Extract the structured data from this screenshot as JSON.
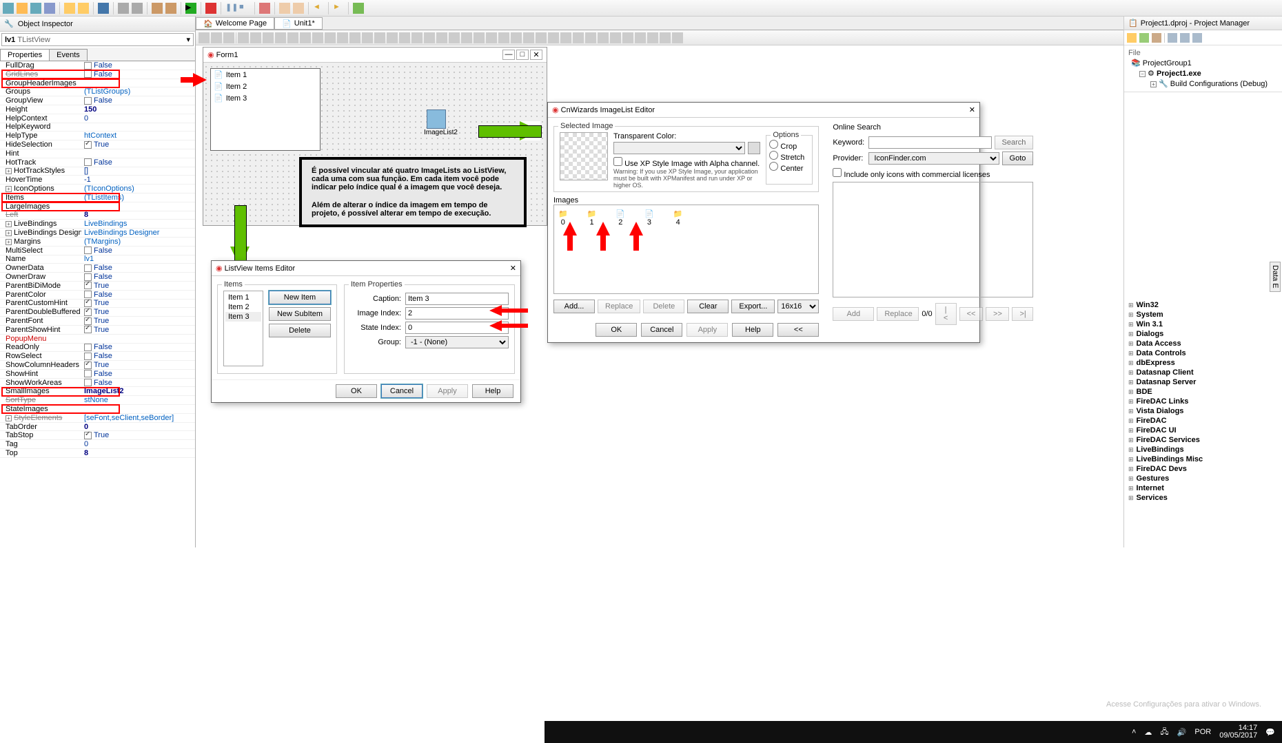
{
  "toolbar_icons": [
    "new",
    "open",
    "open2",
    "save",
    "save-all",
    "sep",
    "folder",
    "add-folder",
    "sep",
    "disk",
    "sep",
    "undo",
    "redo",
    "sep",
    "package",
    "package2",
    "sep",
    "run",
    "sep",
    "bug",
    "sep",
    "pause",
    "step",
    "sep",
    "stop",
    "sep",
    "brush",
    "brush2",
    "sep",
    "nav-back",
    "sep",
    "nav-fwd",
    "sep",
    "books"
  ],
  "object_inspector": {
    "title": "Object Inspector",
    "component": "lv1",
    "component_type": "TListView",
    "tabs": [
      "Properties",
      "Events"
    ],
    "active_tab": 0,
    "properties": [
      {
        "n": "FullDrag",
        "v": "False",
        "chk": false
      },
      {
        "n": "GridLines",
        "v": "False",
        "chk": false,
        "strike": true,
        "boxed": true
      },
      {
        "n": "GroupHeaderImages",
        "v": "",
        "boxed": true
      },
      {
        "n": "Groups",
        "v": "(TListGroups)",
        "link": true
      },
      {
        "n": "GroupView",
        "v": "False",
        "chk": false
      },
      {
        "n": "Height",
        "v": "150",
        "bold": true
      },
      {
        "n": "HelpContext",
        "v": "0"
      },
      {
        "n": "HelpKeyword",
        "v": ""
      },
      {
        "n": "HelpType",
        "v": "htContext",
        "link": true
      },
      {
        "n": "HideSelection",
        "v": "True",
        "chk": true
      },
      {
        "n": "Hint",
        "v": ""
      },
      {
        "n": "HotTrack",
        "v": "False",
        "chk": false
      },
      {
        "n": "HotTrackStyles",
        "v": "[]",
        "exp": true
      },
      {
        "n": "HoverTime",
        "v": "-1"
      },
      {
        "n": "IconOptions",
        "v": "(TIconOptions)",
        "link": true,
        "exp": true
      },
      {
        "n": "Items",
        "v": "(TListItems)",
        "link": true,
        "boxed": true
      },
      {
        "n": "LargeImages",
        "v": "",
        "boxed": true
      },
      {
        "n": "Left",
        "v": "8",
        "bold": true,
        "strike": true
      },
      {
        "n": "LiveBindings",
        "v": "LiveBindings",
        "link": true,
        "exp": true
      },
      {
        "n": "LiveBindings Designer",
        "v": "LiveBindings Designer",
        "link": true,
        "exp": true
      },
      {
        "n": "Margins",
        "v": "(TMargins)",
        "link": true,
        "exp": true
      },
      {
        "n": "MultiSelect",
        "v": "False",
        "chk": false
      },
      {
        "n": "Name",
        "v": "lv1",
        "link": true
      },
      {
        "n": "OwnerData",
        "v": "False",
        "chk": false
      },
      {
        "n": "OwnerDraw",
        "v": "False",
        "chk": false
      },
      {
        "n": "ParentBiDiMode",
        "v": "True",
        "chk": true
      },
      {
        "n": "ParentColor",
        "v": "False",
        "chk": false
      },
      {
        "n": "ParentCustomHint",
        "v": "True",
        "chk": true
      },
      {
        "n": "ParentDoubleBuffered",
        "v": "True",
        "chk": true
      },
      {
        "n": "ParentFont",
        "v": "True",
        "chk": true
      },
      {
        "n": "ParentShowHint",
        "v": "True",
        "chk": true
      },
      {
        "n": "PopupMenu",
        "v": "",
        "red": true
      },
      {
        "n": "ReadOnly",
        "v": "False",
        "chk": false
      },
      {
        "n": "RowSelect",
        "v": "False",
        "chk": false
      },
      {
        "n": "ShowColumnHeaders",
        "v": "True",
        "chk": true
      },
      {
        "n": "ShowHint",
        "v": "False",
        "chk": false
      },
      {
        "n": "ShowWorkAreas",
        "v": "False",
        "chk": false
      },
      {
        "n": "SmallImages",
        "v": "ImageList2",
        "bold": true,
        "boxed": true
      },
      {
        "n": "SortType",
        "v": "stNone",
        "link": true,
        "strike": true
      },
      {
        "n": "StateImages",
        "v": "",
        "boxed": true
      },
      {
        "n": "StyleElements",
        "v": "[seFont,seClient,seBorder]",
        "link": true,
        "strike": true,
        "exp": true
      },
      {
        "n": "TabOrder",
        "v": "0",
        "bold": true
      },
      {
        "n": "TabStop",
        "v": "True",
        "chk": true
      },
      {
        "n": "Tag",
        "v": "0"
      },
      {
        "n": "Top",
        "v": "8",
        "bold": true
      }
    ]
  },
  "doc_tabs": [
    {
      "label": "Welcome Page",
      "icon": "home"
    },
    {
      "label": "Unit1*",
      "icon": "unit"
    }
  ],
  "form": {
    "title": "Form1",
    "lv_items": [
      "Item 1",
      "Item 2",
      "Item 3"
    ],
    "imagelist_label": "ImageList2"
  },
  "note_text_1": "É possível vincular até quatro ImageLists ao ListView, cada uma com sua função. Em cada item você pode indicar pelo índice qual é a imagem que você deseja.",
  "note_text_2": "Além de alterar o índice da imagem em tempo de projeto, é possível alterar em tempo de execução.",
  "listview_editor": {
    "title": "ListView Items Editor",
    "items_label": "Items",
    "items": [
      "Item 1",
      "Item 2",
      "Item 3"
    ],
    "buttons": {
      "new_item": "New Item",
      "new_sub": "New SubItem",
      "delete": "Delete"
    },
    "props_label": "Item Properties",
    "fields": {
      "caption": "Caption:",
      "caption_v": "Item 3",
      "image": "Image Index:",
      "image_v": "2",
      "state": "State Index:",
      "state_v": "0",
      "group": "Group:",
      "group_v": "-1 - (None)"
    },
    "footer": {
      "ok": "OK",
      "cancel": "Cancel",
      "apply": "Apply",
      "help": "Help"
    }
  },
  "cnwizards": {
    "title": "CnWizards ImageList Editor",
    "selected": "Selected Image",
    "transparent": "Transparent Color:",
    "xp_check": "Use XP Style Image with Alpha channel.",
    "xp_warn": "Warning: If you use XP Style Image, your application must be built with XPManifest and run under XP or higher OS.",
    "options": "Options",
    "opt_crop": "Crop",
    "opt_stretch": "Stretch",
    "opt_center": "Center",
    "images_label": "Images",
    "image_indices": [
      "0",
      "1",
      "2",
      "3",
      "4"
    ],
    "btn_add": "Add...",
    "btn_replace": "Replace",
    "btn_delete": "Delete",
    "btn_clear": "Clear",
    "btn_export": "Export...",
    "size": "16x16",
    "online": "Online Search",
    "keyword": "Keyword:",
    "search": "Search",
    "provider": "Provider:",
    "provider_v": "IconFinder.com",
    "goto": "Goto",
    "commercial": "Include only icons with commercial licenses",
    "btn_add2": "Add",
    "btn_replace2": "Replace",
    "counter": "0/0",
    "ok": "OK",
    "cancel": "Cancel",
    "apply": "Apply",
    "help": "Help",
    "back": "<<"
  },
  "project_manager": {
    "title": "Project1.dproj - Project Manager",
    "file": "File",
    "tree": [
      "ProjectGroup1",
      "Project1.exe",
      "Build Configurations (Debug)"
    ]
  },
  "palette": [
    "Win32",
    "System",
    "Win 3.1",
    "Dialogs",
    "Data Access",
    "Data Controls",
    "dbExpress",
    "Datasnap Client",
    "Datasnap Server",
    "BDE",
    "FireDAC Links",
    "Vista Dialogs",
    "FireDAC",
    "FireDAC UI",
    "FireDAC Services",
    "LiveBindings",
    "LiveBindings Misc",
    "FireDAC Devs",
    "Gestures",
    "Internet",
    "Services"
  ],
  "watermark": {
    "line1": "Acesse Configurações para ativar o Windows."
  },
  "taskbar": {
    "lang": "POR",
    "time": "14:17",
    "date": "09/05/2017"
  },
  "data_panel": "Data E"
}
